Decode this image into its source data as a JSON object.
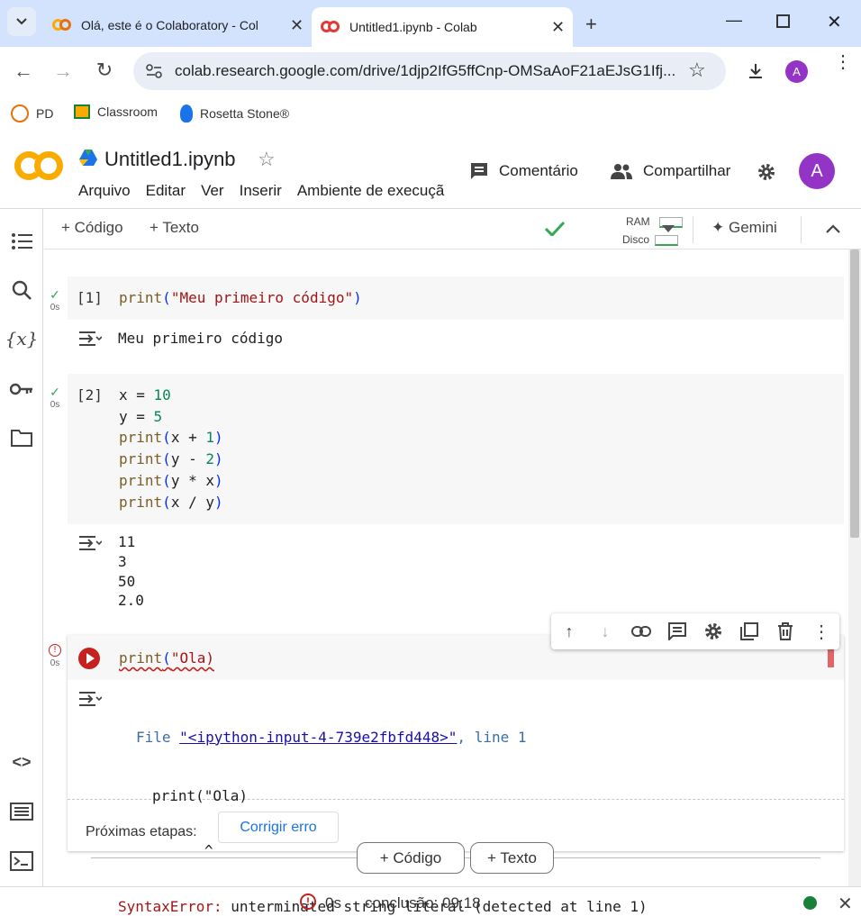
{
  "browser": {
    "tabs": [
      {
        "title": "Olá, este é o Colaboratory - Col",
        "active": false
      },
      {
        "title": "Untitled1.ipynb - Colab",
        "active": true
      }
    ],
    "url": "colab.research.google.com/drive/1djp2IfG5ffCnp-OMSaAoF21aEJsG1Ifj...",
    "profile_initial": "A",
    "bookmarks": [
      "PD",
      "Classroom",
      "Rosetta Stone®"
    ]
  },
  "colab": {
    "notebook_title": "Untitled1.ipynb",
    "menu": [
      "Arquivo",
      "Editar",
      "Ver",
      "Inserir",
      "Ambiente de execuçã"
    ],
    "comment_label": "Comentário",
    "share_label": "Compartilhar",
    "avatar_initial": "A",
    "toolbar": {
      "add_code": "+ Código",
      "add_text": "+ Texto",
      "ram_label": "RAM",
      "disk_label": "Disco",
      "gemini_label": "Gemini"
    }
  },
  "cells": [
    {
      "prompt": "[1]",
      "time": "0s",
      "code": [
        "print(\"Meu primeiro código\")"
      ],
      "output": [
        "Meu primeiro código"
      ]
    },
    {
      "prompt": "[2]",
      "time": "0s",
      "code": [
        "x = 10",
        "y = 5",
        "print(x + 1)",
        "print(y - 2)",
        "print(y * x)",
        "print(x / y)"
      ],
      "output": [
        "11",
        "3",
        "50",
        "2.0"
      ]
    },
    {
      "time": "0s",
      "code": [
        "print(\"Ola)"
      ],
      "error": {
        "file_prefix": "File ",
        "file_link": "\"<ipython-input-4-739e2fbfd448>\"",
        "line_text": ", line 1",
        "source_line": "print(\"Ola)",
        "caret": "^",
        "error_type": "SyntaxError:",
        "error_message": " unterminated string literal (detected at line 1)"
      },
      "next_steps_label": "Próximas etapas:",
      "fix_button": "Corrigir erro"
    }
  ],
  "add_code_button": "+ Código",
  "add_text_button": "+ Texto",
  "status_bar": {
    "time": "0s",
    "completion": "conclusão: 09:18"
  },
  "colors": {
    "tab_bg": "#d3e3fd",
    "error_red": "#c5221f",
    "success_green": "#34a853",
    "avatar_purple": "#9334c7",
    "link_blue": "#1a73e8"
  }
}
